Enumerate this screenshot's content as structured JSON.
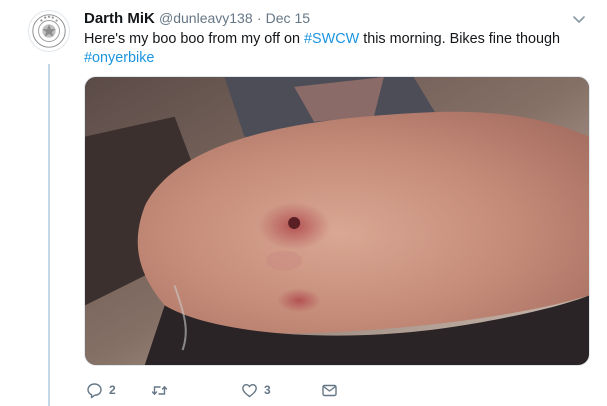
{
  "tweet": {
    "author_name": "Darth MiK",
    "author_handle": "@dunleavy138",
    "separator": "·",
    "date": "Dec 15",
    "text_part1": "Here's my boo boo from my off on ",
    "hashtag1": "#SWCW",
    "text_part2": " this morning. Bikes fine though",
    "hashtag2": "#onyerbike",
    "avatar_icon": "club-crest-icon",
    "hashtag_color": "#1b95e0"
  },
  "actions": {
    "reply_count": "2",
    "retweet_count": "",
    "like_count": "3"
  },
  "colors": {
    "muted": "#657786",
    "thread_line": "#c4d9e8"
  }
}
